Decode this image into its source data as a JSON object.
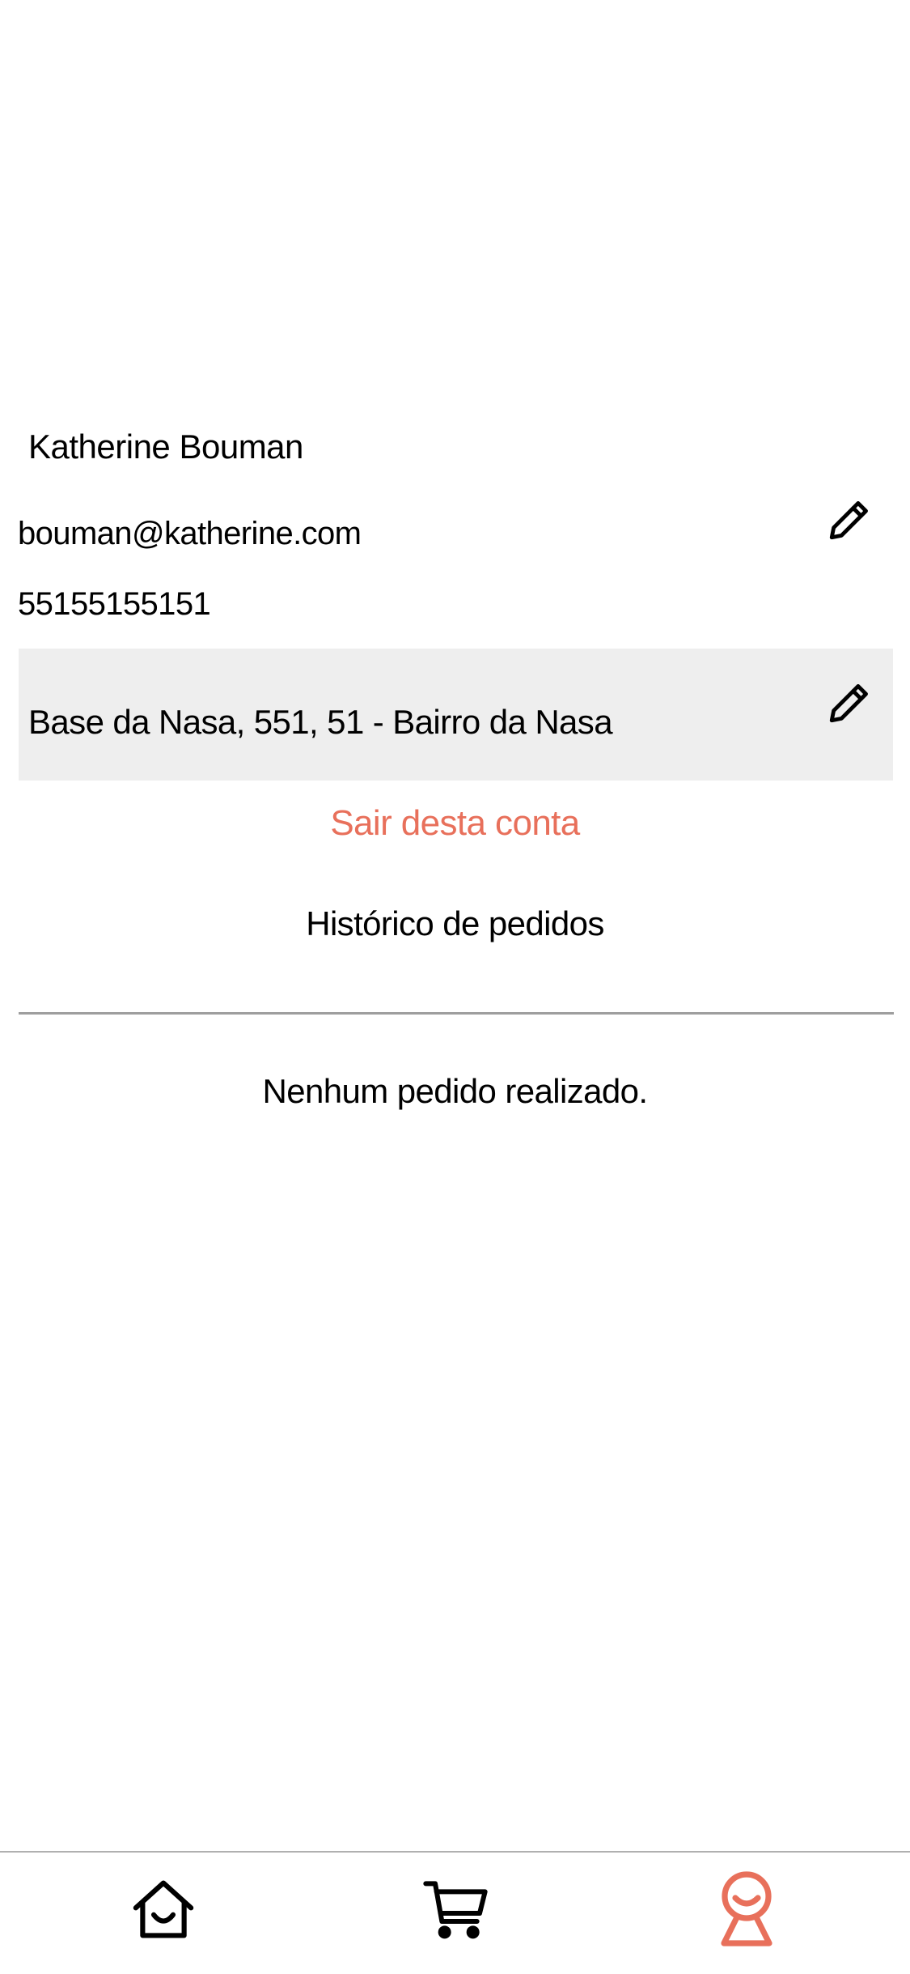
{
  "profile": {
    "name": "Katherine Bouman",
    "email": "bouman@katherine.com",
    "phone": "55155155151",
    "edit_icon": "pencil-icon"
  },
  "address": {
    "text": "Base da Nasa, 551, 51 - Bairro da Nasa",
    "edit_icon": "pencil-icon"
  },
  "logout_label": "Sair desta conta",
  "orders": {
    "title": "Histórico de pedidos",
    "empty_message": "Nenhum pedido realizado."
  },
  "bottom_nav": {
    "items": [
      {
        "icon": "home-icon",
        "active": false
      },
      {
        "icon": "cart-icon",
        "active": false
      },
      {
        "icon": "profile-icon",
        "active": true
      }
    ]
  },
  "colors": {
    "accent": "#e8705b",
    "address_background": "#eeeeee",
    "divider": "#9e9e9e",
    "text": "#000000"
  }
}
